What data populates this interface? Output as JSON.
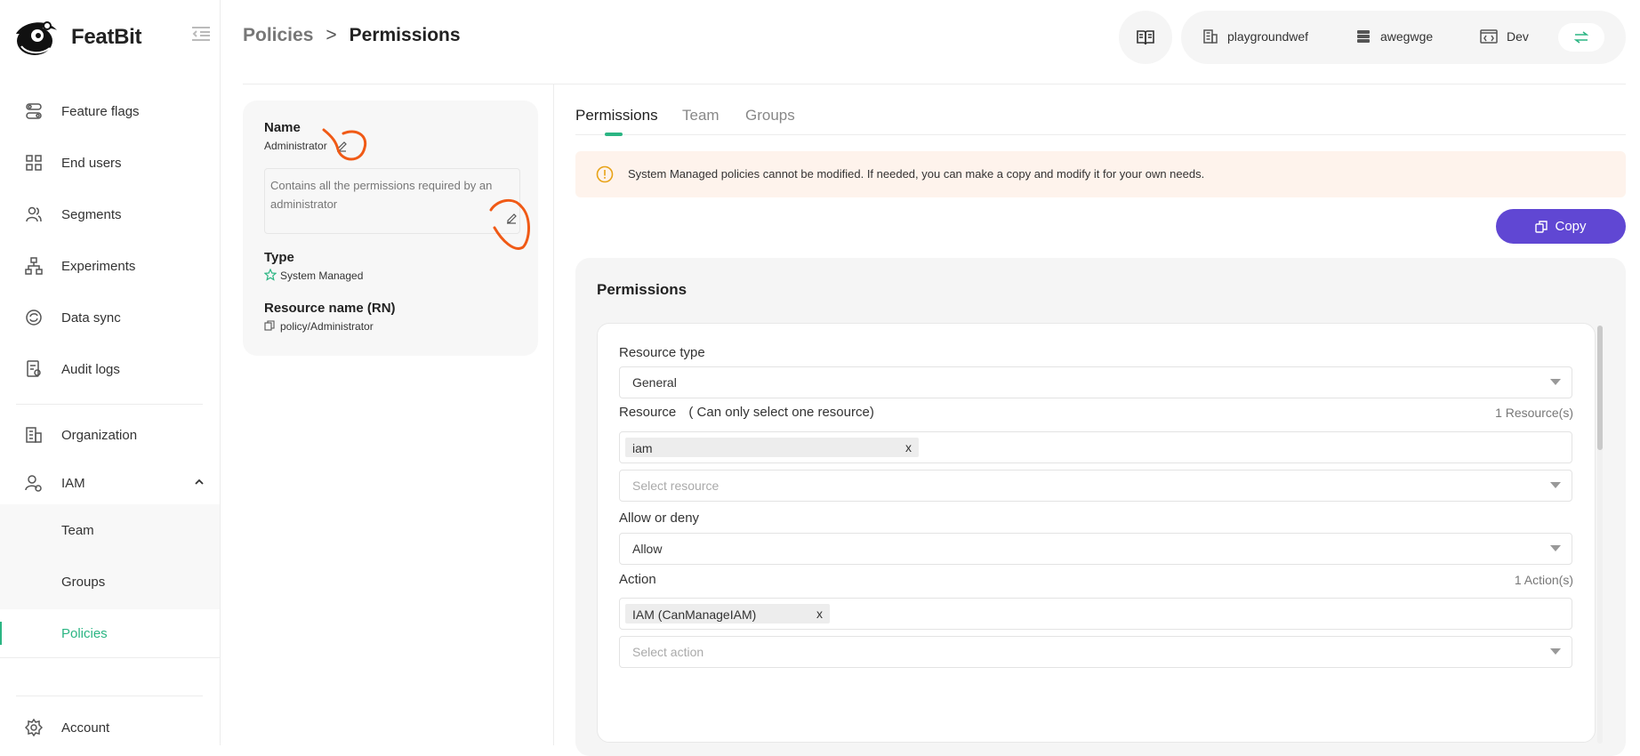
{
  "app": {
    "name": "FeatBit"
  },
  "sidebar": {
    "items": [
      {
        "label": "Feature flags",
        "icon": "toggles-icon"
      },
      {
        "label": "End users",
        "icon": "grid-icon"
      },
      {
        "label": "Segments",
        "icon": "users-icon"
      },
      {
        "label": "Experiments",
        "icon": "hierarchy-icon"
      },
      {
        "label": "Data sync",
        "icon": "sync-icon"
      },
      {
        "label": "Audit logs",
        "icon": "audit-icon"
      }
    ],
    "org_label": "Organization",
    "iam_label": "IAM",
    "iam_sub": [
      {
        "label": "Team"
      },
      {
        "label": "Groups"
      },
      {
        "label": "Policies"
      }
    ],
    "account_label": "Account"
  },
  "breadcrumb": {
    "parent": "Policies",
    "separator": ">",
    "current": "Permissions"
  },
  "context": {
    "organization": "playgroundwef",
    "project": "awegwge",
    "environment": "Dev"
  },
  "policy": {
    "name_label": "Name",
    "name": "Administrator",
    "description": "Contains all the permissions required by an administrator",
    "type_label": "Type",
    "type": "System Managed",
    "rn_label": "Resource name (RN)",
    "rn": "policy/Administrator"
  },
  "tabs": [
    {
      "label": "Permissions"
    },
    {
      "label": "Team"
    },
    {
      "label": "Groups"
    }
  ],
  "alert": {
    "text": "System Managed policies cannot be modified. If needed, you can make a copy and modify it for your own needs."
  },
  "copy_label": "Copy",
  "permissions": {
    "title": "Permissions",
    "resource_type_label": "Resource type",
    "resource_type": "General",
    "resource_label": "Resource",
    "resource_hint": "( Can only select one resource)",
    "resource_count": "1 Resource(s)",
    "resource_tag": "iam",
    "resource_placeholder": "Select resource",
    "effect_label": "Allow or deny",
    "effect": "Allow",
    "action_label": "Action",
    "action_count": "1 Action(s)",
    "action_tag": "IAM (CanManageIAM)",
    "action_placeholder": "Select action",
    "remove_symbol": "x"
  },
  "colors": {
    "accent": "#2bb583",
    "primary": "#6047d3",
    "alert_bg": "#fef3ec",
    "annotation": "#f05a16"
  }
}
